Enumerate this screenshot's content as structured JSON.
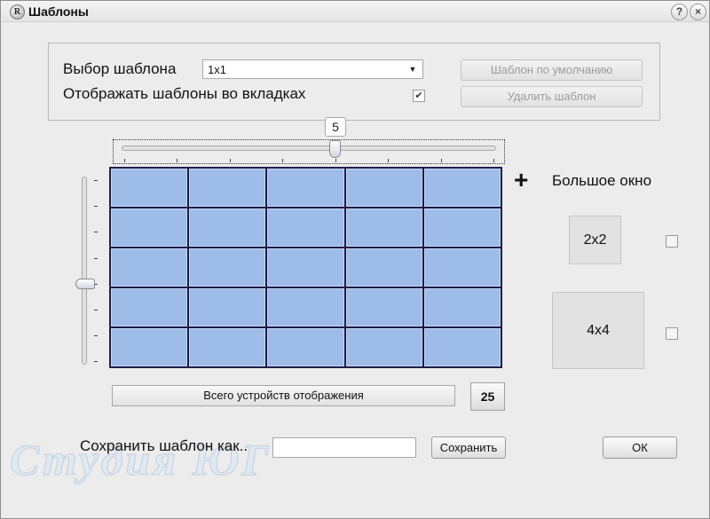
{
  "window": {
    "title": "Шаблоны",
    "app_icon_text": "R",
    "help_button": "?",
    "close_button": "×"
  },
  "template_panel": {
    "select_label": "Выбор шаблона",
    "selected_template": "1x1",
    "dropdown_icon": "triangle-down",
    "show_in_tabs_label": "Отображать шаблоны во вкладках",
    "show_in_tabs_checked": true,
    "default_template_button": "Шаблон по умолчанию",
    "delete_template_button": "Удалить шаблон"
  },
  "grid": {
    "columns_slider_value": "5",
    "columns": 5,
    "rows": 5,
    "cell_color": "#9ebce8",
    "border_color": "#1a1a4a"
  },
  "big_window": {
    "plus_sign": "+",
    "label": "Большое окно",
    "presets": [
      {
        "label": "2x2",
        "checked": false
      },
      {
        "label": "4x4",
        "checked": false
      }
    ]
  },
  "totals": {
    "label": "Всего устройств отображения",
    "count": "25"
  },
  "save": {
    "label": "Сохранить шаблон как..",
    "input_value": "",
    "save_button": "Сохранить",
    "ok_button": "ОК"
  },
  "watermark": "Студия ЮГ"
}
